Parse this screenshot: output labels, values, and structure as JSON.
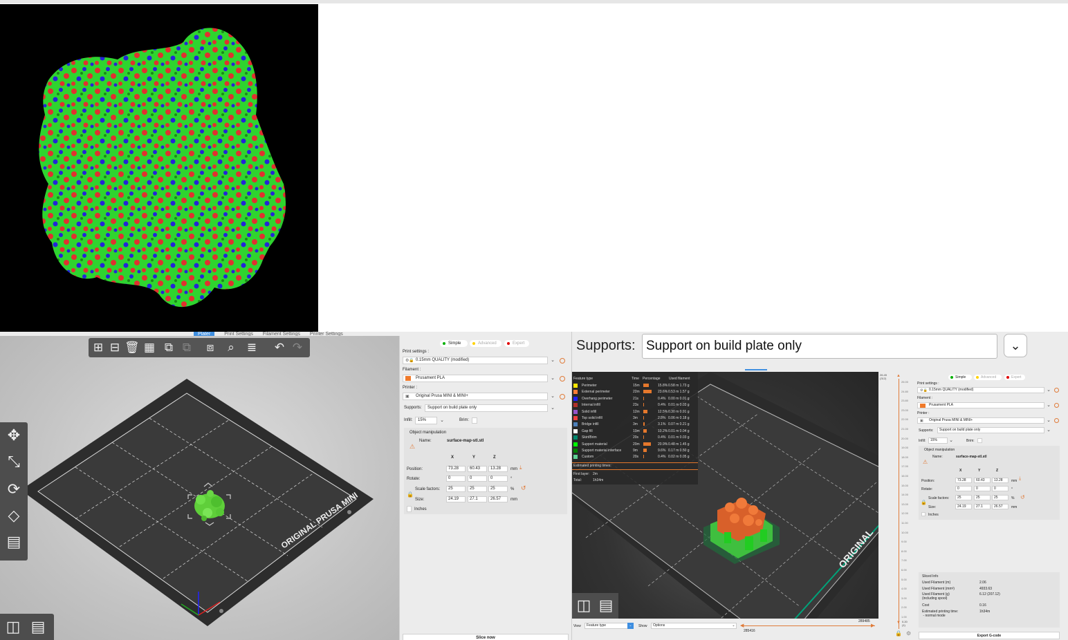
{
  "left_app": {
    "tabs": [
      "Plater",
      "Print Settings",
      "Filament Settings",
      "Printer Settings"
    ],
    "bed_text": "ORIGINAL PRUSA MINI",
    "modes": [
      "Simple",
      "Advanced",
      "Expert"
    ],
    "mode_colors": [
      "#00b000",
      "#ffd200",
      "#e00000"
    ],
    "print_settings_label": "Print settings :",
    "print_settings_value": "0.15mm QUALITY (modified)",
    "filament_label": "Filament :",
    "filament_value": "Prusament PLA",
    "printer_label": "Printer :",
    "printer_value": "Original Prusa MINI & MINI+",
    "supports_label": "Supports:",
    "supports_value": "Support on build plate only",
    "infill_label": "Infill:",
    "infill_value": "15%",
    "brim_label": "Brim:",
    "object_manipulation": "Object manipulation",
    "name_label": "Name:",
    "name_value": "surface-map-stl.stl",
    "axes": [
      "X",
      "Y",
      "Z"
    ],
    "position_label": "Position:",
    "position": [
      "73.28",
      "60.43",
      "13.28"
    ],
    "position_unit": "mm",
    "rotate_label": "Rotate:",
    "rotate": [
      "0",
      "0",
      "0"
    ],
    "rotate_unit": "°",
    "scale_label": "Scale factors:",
    "scale": [
      "25",
      "25",
      "25"
    ],
    "scale_unit": "%",
    "size_label": "Size:",
    "size": [
      "24.19",
      "27.1",
      "26.57"
    ],
    "size_unit": "mm",
    "inches_label": "Inches",
    "slice_button": "Slice now"
  },
  "right_app": {
    "supports_label": "Supports:",
    "supports_value": "Support on build plate only",
    "bed_text": "ORIGINAL",
    "legend": {
      "headers": [
        "Feature type",
        "Time",
        "Percentage",
        "Used filament"
      ],
      "rows": [
        {
          "name": "Perimeter",
          "color": "#ffe600",
          "time": "15m",
          "pct": "15.8%",
          "pct_value": 15.8,
          "used": "0.58 m   1.73 g"
        },
        {
          "name": "External perimeter",
          "color": "#ff7d38",
          "time": "22m",
          "pct": "23.6%",
          "pct_value": 23.6,
          "used": "0.53 m   1.57 g"
        },
        {
          "name": "Overhang perimeter",
          "color": "#1f1fff",
          "time": "21s",
          "pct": "0.4%",
          "pct_value": 0.4,
          "used": "0.00 m   0.01 g"
        },
        {
          "name": "Internal infill",
          "color": "#b03029",
          "time": "23s",
          "pct": "0.4%",
          "pct_value": 0.4,
          "used": "0.01 m   0.03 g"
        },
        {
          "name": "Solid infill",
          "color": "#9654cc",
          "time": "12m",
          "pct": "12.5%",
          "pct_value": 12.5,
          "used": "0.30 m   0.91 g"
        },
        {
          "name": "Top solid infill",
          "color": "#f04040",
          "time": "3m",
          "pct": "2.8%",
          "pct_value": 2.8,
          "used": "0.06 m   0.18 g"
        },
        {
          "name": "Bridge infill",
          "color": "#4d80ba",
          "time": "3m",
          "pct": "3.1%",
          "pct_value": 3.1,
          "used": "0.07 m   0.21 g"
        },
        {
          "name": "Gap fill",
          "color": "#ffffff",
          "time": "10m",
          "pct": "10.2%",
          "pct_value": 10.2,
          "used": "0.01 m   0.04 g"
        },
        {
          "name": "Skirt/Brim",
          "color": "#00876e",
          "time": "20s",
          "pct": "0.4%",
          "pct_value": 0.4,
          "used": "0.01 m   0.03 g"
        },
        {
          "name": "Support material",
          "color": "#00ff00",
          "time": "20m",
          "pct": "20.9%",
          "pct_value": 20.9,
          "used": "0.48 m   1.45 g"
        },
        {
          "name": "Support material interface",
          "color": "#008000",
          "time": "9m",
          "pct": "9.6%",
          "pct_value": 9.6,
          "used": "0.17 m   0.50 g"
        },
        {
          "name": "Custom",
          "color": "#5ed194",
          "time": "20s",
          "pct": "0.4%",
          "pct_value": 0.4,
          "used": "0.02 m   0.05 g"
        }
      ],
      "estimated_label": "Estimated printing times:",
      "first_layer_label": "First layer:",
      "first_layer_value": "2m",
      "total_label": "Total:",
      "total_value": "1h34m"
    },
    "slider_top": "26.45",
    "slider_top_layer": "(312)",
    "slider_ticks": [
      "26.00",
      "24.80",
      "23.80",
      "23.00",
      "22.00",
      "21.00",
      "20.00",
      "19.00",
      "18.00",
      "17.00",
      "16.00",
      "15.00",
      "14.00",
      "13.00",
      "12.00",
      "11.00",
      "10.00",
      "9.00",
      "8.00",
      "7.00",
      "6.00",
      "5.00",
      "4.00",
      "3.00",
      "2.00",
      "1.00"
    ],
    "slider_bottom": "0.20",
    "slider_bottom_layer": "(1)",
    "view_label": "View",
    "view_value": "Feature type",
    "show_label": "Show",
    "show_value": "Options",
    "horizontal_left": "285416",
    "horizontal_right": "289485",
    "sliced_info": {
      "title": "Sliced Info",
      "rows": [
        {
          "label": "Used Filament (m)",
          "value": "2.06"
        },
        {
          "label": "Used Filament (mm³)",
          "value": "4933.63"
        },
        {
          "label": "Used Filament (g)\n(including spool)",
          "value": "6.12 (207.12)"
        },
        {
          "label": "Cost",
          "value": "0.16"
        },
        {
          "label": "Estimated printing time:\n - normal mode",
          "value": "1h34m"
        }
      ]
    },
    "export_button": "Export G-code"
  }
}
